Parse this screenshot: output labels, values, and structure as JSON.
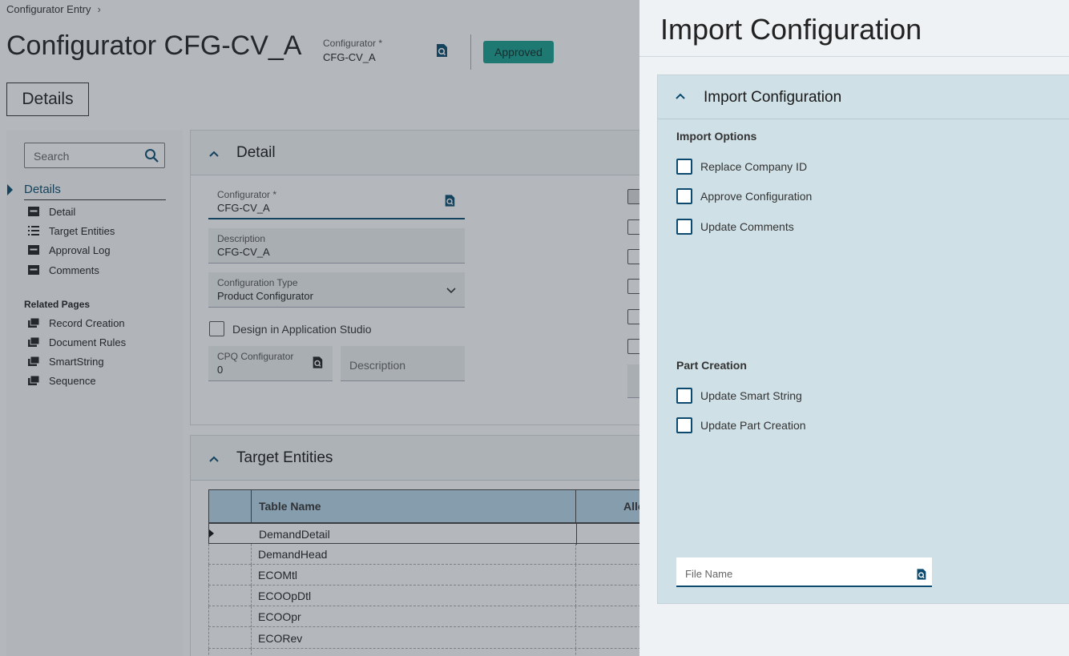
{
  "breadcrumb": {
    "label": "Configurator Entry",
    "chevron": "›"
  },
  "header": {
    "title": "Configurator CFG-CV_A",
    "field_label": "Configurator *",
    "field_value": "CFG-CV_A",
    "status": "Approved",
    "status_color": "#1b9e8f"
  },
  "details_button": "Details",
  "sidebar": {
    "search_placeholder": "Search",
    "section": "Details",
    "items": [
      {
        "label": "Detail",
        "icon": "card-icon"
      },
      {
        "label": "Target Entities",
        "icon": "list-icon"
      },
      {
        "label": "Approval Log",
        "icon": "card-icon"
      },
      {
        "label": "Comments",
        "icon": "card-icon"
      }
    ],
    "related_title": "Related Pages",
    "related": [
      {
        "label": "Record Creation",
        "icon": "pages-icon"
      },
      {
        "label": "Document Rules",
        "icon": "pages-icon"
      },
      {
        "label": "SmartString",
        "icon": "pages-icon"
      },
      {
        "label": "Sequence",
        "icon": "pages-icon"
      }
    ]
  },
  "detail": {
    "title": "Detail",
    "configurator_label": "Configurator *",
    "configurator_value": "CFG-CV_A",
    "description_label": "Description",
    "description_value": "CFG-CV_A",
    "type_label": "Configuration Type",
    "type_value": "Product Configurator",
    "design_label": "Design in Application Studio",
    "cpq_label": "CPQ Configurator",
    "cpq_value": "0",
    "cpq_desc_placeholder": "Description"
  },
  "target_entities": {
    "title": "Target Entities",
    "columns": [
      "Table Name",
      "Allo"
    ],
    "rows": [
      "DemandDetail",
      "DemandHead",
      "ECOMtl",
      "ECOOpDtl",
      "ECOOpr",
      "ECORev"
    ]
  },
  "import_panel": {
    "title": "Import Configuration",
    "section_title": "Import Configuration",
    "import_options_title": "Import Options",
    "import_options": [
      "Replace Company ID",
      "Approve Configuration",
      "Update Comments"
    ],
    "part_creation_title": "Part Creation",
    "part_creation": [
      "Update Smart String",
      "Update Part Creation"
    ],
    "file_name_placeholder": "File Name"
  },
  "colors": {
    "accent": "#0b4a6e",
    "panel_bg": "#cfe0e6",
    "grid_header": "#b9d6e8"
  }
}
